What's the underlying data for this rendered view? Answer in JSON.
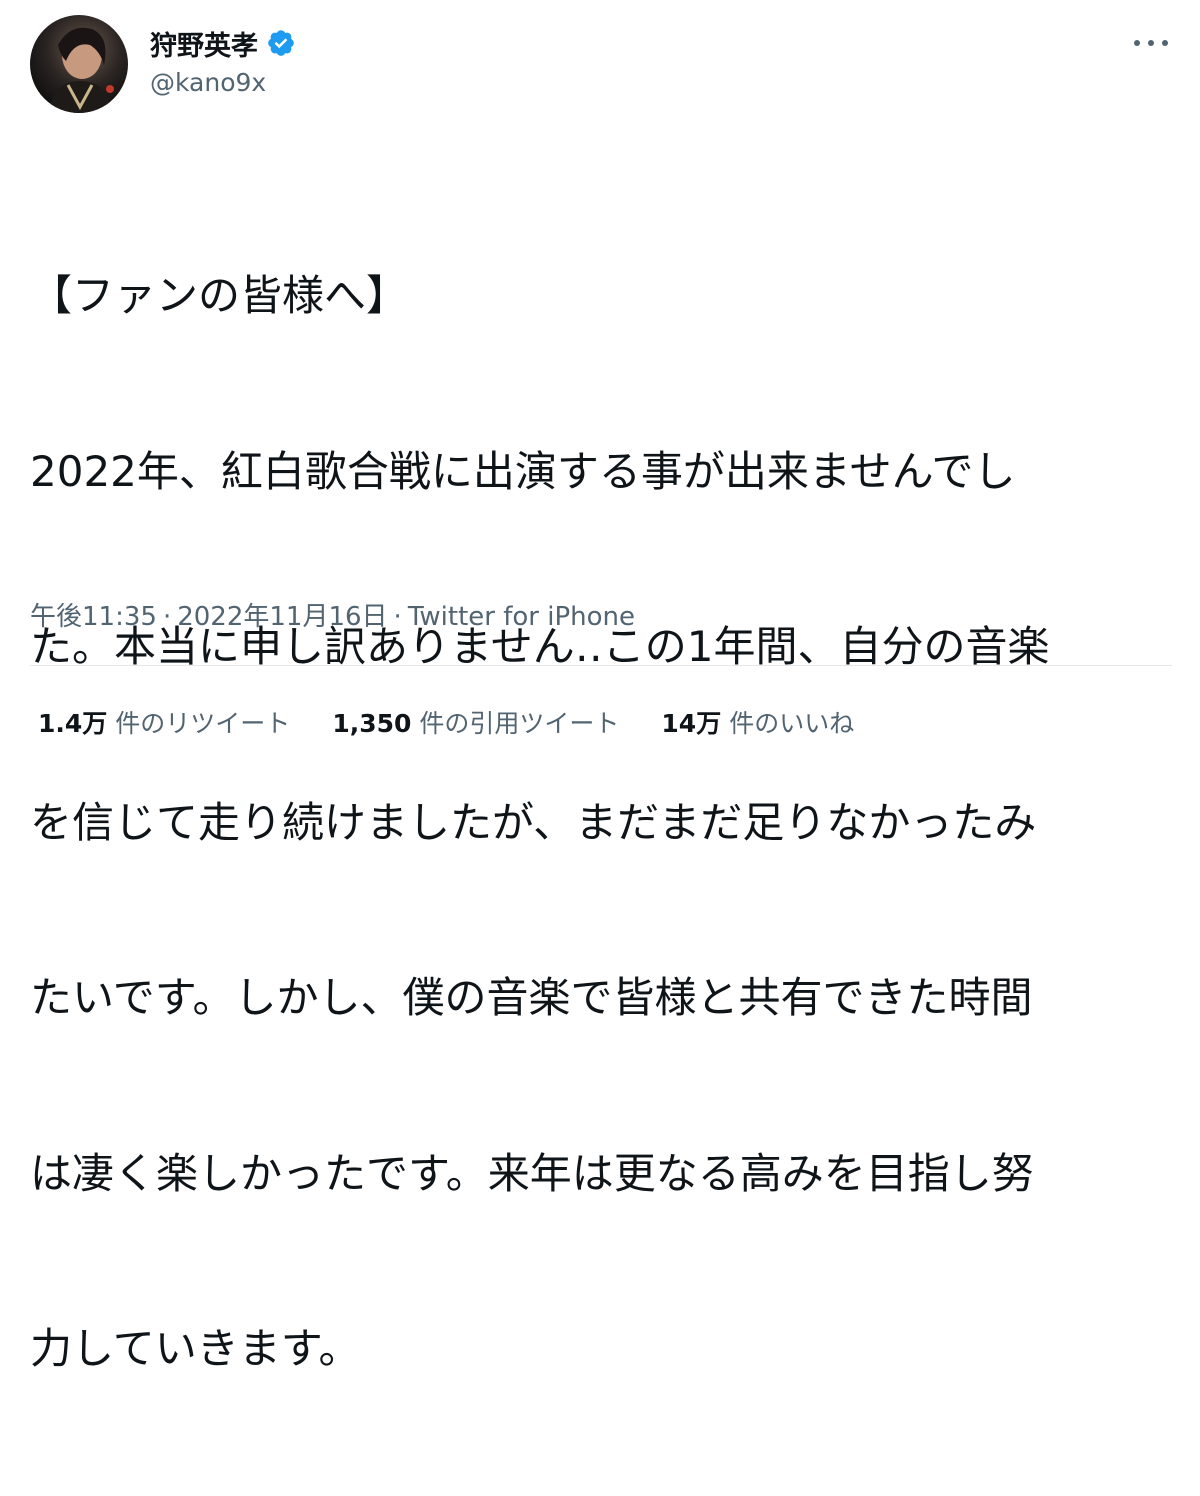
{
  "author": {
    "display_name": "狩野英孝",
    "handle": "@kano9x",
    "verified": true
  },
  "tweet": {
    "lines": [
      "【ファンの皆様へ】",
      "2022年、紅白歌合戦に出演する事が出来ませんでし",
      "た。本当に申し訳ありません‥この1年間、自分の音楽",
      "を信じて走り続けましたが、まだまだ足りなかったみ",
      "たいです。しかし、僕の音楽で皆様と共有できた時間",
      "は凄く楽しかったです。来年は更なる高みを目指し努",
      "力していきます。"
    ],
    "time": "午後11:35",
    "separator": "·",
    "date": "2022年11月16日",
    "source": "Twitter for iPhone"
  },
  "stats": {
    "retweets_count": "1.4万",
    "retweets_label": "件のリツイート",
    "quotes_count": "1,350",
    "quotes_label": "件の引用ツイート",
    "likes_count": "14万",
    "likes_label": "件のいいね"
  },
  "icons": {
    "verified": "verified-badge-icon",
    "more": "more-options-icon"
  },
  "colors": {
    "text": "#0f1419",
    "secondary": "#536471",
    "verified": "#1d9bf0",
    "divider": "#e4e8eb"
  }
}
